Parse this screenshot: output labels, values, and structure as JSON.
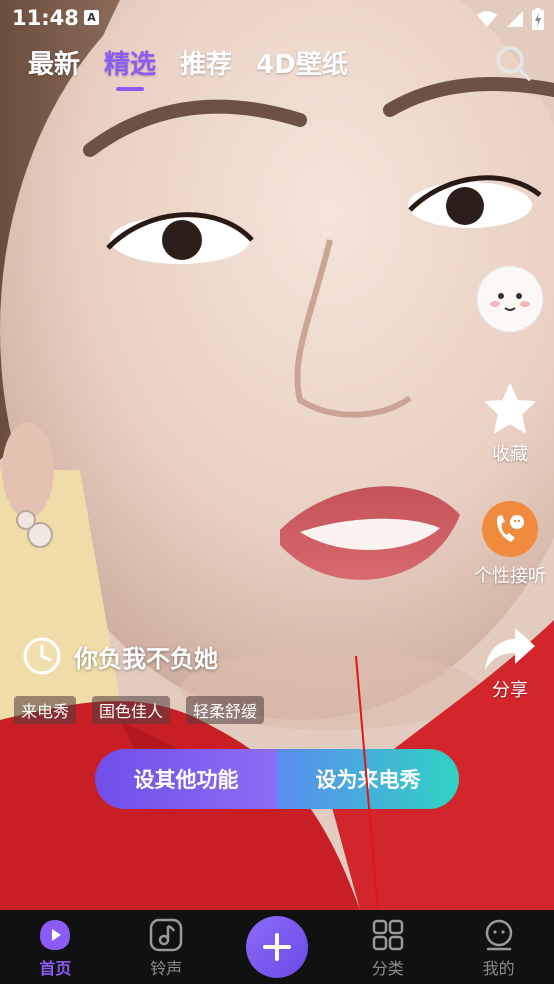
{
  "status_bar": {
    "time": "11:48",
    "notification_icon": "A"
  },
  "top_tabs": [
    {
      "label": "最新",
      "active": false
    },
    {
      "label": "精选",
      "active": true
    },
    {
      "label": "推荐",
      "active": false
    },
    {
      "label": "4D壁纸",
      "active": false
    }
  ],
  "actions": {
    "favorite_label": "收藏",
    "ringback_label": "个性接听",
    "share_label": "分享"
  },
  "content": {
    "title": "你负我不负她",
    "tags": [
      "来电秀",
      "国色佳人",
      "轻柔舒缓"
    ]
  },
  "buttons": {
    "other_label": "设其他功能",
    "set_call_show_label": "设为来电秀"
  },
  "bottom_nav": [
    {
      "label": "首页",
      "icon": "home-play-icon",
      "active": true
    },
    {
      "label": "铃声",
      "icon": "music-note-icon",
      "active": false
    },
    {
      "label": "",
      "icon": "plus-icon",
      "active": false
    },
    {
      "label": "分类",
      "icon": "grid-icon",
      "active": false
    },
    {
      "label": "我的",
      "icon": "profile-icon",
      "active": false
    }
  ],
  "colors": {
    "accent": "#8a5cf5",
    "button_left": "#7a5af0",
    "button_right": "#2fd3c2",
    "nav_bg": "#111111",
    "ringback_orange": "#f08a3c"
  }
}
